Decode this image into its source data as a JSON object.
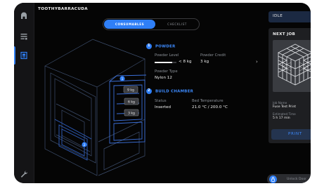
{
  "printer": {
    "name": "TOOTHYBARRACUDA"
  },
  "tabs": [
    {
      "label": "CONSUMABLES",
      "active": true
    },
    {
      "label": "CHECKLIST",
      "active": false
    }
  ],
  "machine_callouts": [
    {
      "label": "1",
      "kind": "badge"
    },
    {
      "label": "9 kg",
      "kind": "tag"
    },
    {
      "label": "6 kg",
      "kind": "tag"
    },
    {
      "label": "3 kg",
      "kind": "tag"
    },
    {
      "label": "2",
      "kind": "badge"
    }
  ],
  "powder": {
    "index": "1",
    "heading": "POWDER",
    "level_label": "Powder Level",
    "level_value": "< 8 kg",
    "level_fraction": 0.8,
    "credit_label": "Powder Credit",
    "credit_value": "3 kg",
    "type_label": "Powder Type",
    "type_value": "Nylon 12"
  },
  "build_chamber": {
    "index": "2",
    "heading": "BUILD CHAMBER",
    "status_label": "Status",
    "status_value": "Inserted",
    "bed_label": "Bed Temperature",
    "bed_value": "21.0 °C / 200.0 °C"
  },
  "status": {
    "text": "IDLE"
  },
  "next_job": {
    "title": "NEXT JOB",
    "job_name_label": "Job Name",
    "job_name": "Fuse Test Print",
    "time_label": "Estimated Time",
    "time_value": "5 h 17 min",
    "print_label": "PRINT"
  },
  "unlock": {
    "label": "Unlock Door"
  },
  "colors": {
    "accent": "#2f7ff7",
    "background": "#050505",
    "panel": "#1e1f22"
  },
  "icons": [
    "home-icon",
    "list-icon",
    "printer-icon",
    "wrench-icon",
    "expand-icon",
    "lock-icon",
    "chevron-right-icon"
  ]
}
